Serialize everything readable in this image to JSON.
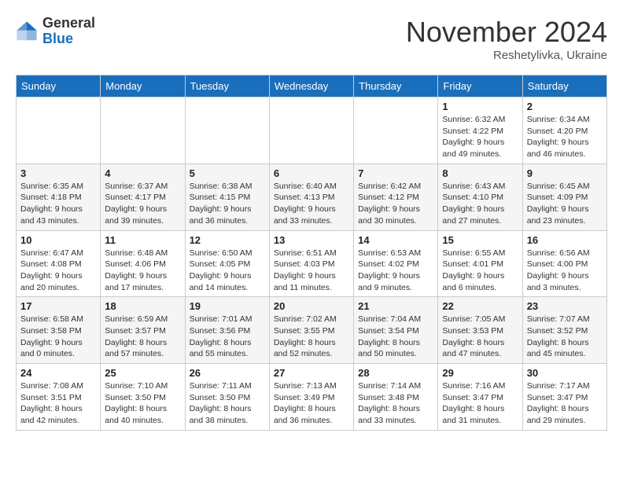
{
  "logo": {
    "general": "General",
    "blue": "Blue"
  },
  "title": "November 2024",
  "subtitle": "Reshetylivka, Ukraine",
  "days_of_week": [
    "Sunday",
    "Monday",
    "Tuesday",
    "Wednesday",
    "Thursday",
    "Friday",
    "Saturday"
  ],
  "weeks": [
    [
      {
        "day": "",
        "detail": ""
      },
      {
        "day": "",
        "detail": ""
      },
      {
        "day": "",
        "detail": ""
      },
      {
        "day": "",
        "detail": ""
      },
      {
        "day": "",
        "detail": ""
      },
      {
        "day": "1",
        "detail": "Sunrise: 6:32 AM\nSunset: 4:22 PM\nDaylight: 9 hours and 49 minutes."
      },
      {
        "day": "2",
        "detail": "Sunrise: 6:34 AM\nSunset: 4:20 PM\nDaylight: 9 hours and 46 minutes."
      }
    ],
    [
      {
        "day": "3",
        "detail": "Sunrise: 6:35 AM\nSunset: 4:18 PM\nDaylight: 9 hours and 43 minutes."
      },
      {
        "day": "4",
        "detail": "Sunrise: 6:37 AM\nSunset: 4:17 PM\nDaylight: 9 hours and 39 minutes."
      },
      {
        "day": "5",
        "detail": "Sunrise: 6:38 AM\nSunset: 4:15 PM\nDaylight: 9 hours and 36 minutes."
      },
      {
        "day": "6",
        "detail": "Sunrise: 6:40 AM\nSunset: 4:13 PM\nDaylight: 9 hours and 33 minutes."
      },
      {
        "day": "7",
        "detail": "Sunrise: 6:42 AM\nSunset: 4:12 PM\nDaylight: 9 hours and 30 minutes."
      },
      {
        "day": "8",
        "detail": "Sunrise: 6:43 AM\nSunset: 4:10 PM\nDaylight: 9 hours and 27 minutes."
      },
      {
        "day": "9",
        "detail": "Sunrise: 6:45 AM\nSunset: 4:09 PM\nDaylight: 9 hours and 23 minutes."
      }
    ],
    [
      {
        "day": "10",
        "detail": "Sunrise: 6:47 AM\nSunset: 4:08 PM\nDaylight: 9 hours and 20 minutes."
      },
      {
        "day": "11",
        "detail": "Sunrise: 6:48 AM\nSunset: 4:06 PM\nDaylight: 9 hours and 17 minutes."
      },
      {
        "day": "12",
        "detail": "Sunrise: 6:50 AM\nSunset: 4:05 PM\nDaylight: 9 hours and 14 minutes."
      },
      {
        "day": "13",
        "detail": "Sunrise: 6:51 AM\nSunset: 4:03 PM\nDaylight: 9 hours and 11 minutes."
      },
      {
        "day": "14",
        "detail": "Sunrise: 6:53 AM\nSunset: 4:02 PM\nDaylight: 9 hours and 9 minutes."
      },
      {
        "day": "15",
        "detail": "Sunrise: 6:55 AM\nSunset: 4:01 PM\nDaylight: 9 hours and 6 minutes."
      },
      {
        "day": "16",
        "detail": "Sunrise: 6:56 AM\nSunset: 4:00 PM\nDaylight: 9 hours and 3 minutes."
      }
    ],
    [
      {
        "day": "17",
        "detail": "Sunrise: 6:58 AM\nSunset: 3:58 PM\nDaylight: 9 hours and 0 minutes."
      },
      {
        "day": "18",
        "detail": "Sunrise: 6:59 AM\nSunset: 3:57 PM\nDaylight: 8 hours and 57 minutes."
      },
      {
        "day": "19",
        "detail": "Sunrise: 7:01 AM\nSunset: 3:56 PM\nDaylight: 8 hours and 55 minutes."
      },
      {
        "day": "20",
        "detail": "Sunrise: 7:02 AM\nSunset: 3:55 PM\nDaylight: 8 hours and 52 minutes."
      },
      {
        "day": "21",
        "detail": "Sunrise: 7:04 AM\nSunset: 3:54 PM\nDaylight: 8 hours and 50 minutes."
      },
      {
        "day": "22",
        "detail": "Sunrise: 7:05 AM\nSunset: 3:53 PM\nDaylight: 8 hours and 47 minutes."
      },
      {
        "day": "23",
        "detail": "Sunrise: 7:07 AM\nSunset: 3:52 PM\nDaylight: 8 hours and 45 minutes."
      }
    ],
    [
      {
        "day": "24",
        "detail": "Sunrise: 7:08 AM\nSunset: 3:51 PM\nDaylight: 8 hours and 42 minutes."
      },
      {
        "day": "25",
        "detail": "Sunrise: 7:10 AM\nSunset: 3:50 PM\nDaylight: 8 hours and 40 minutes."
      },
      {
        "day": "26",
        "detail": "Sunrise: 7:11 AM\nSunset: 3:50 PM\nDaylight: 8 hours and 38 minutes."
      },
      {
        "day": "27",
        "detail": "Sunrise: 7:13 AM\nSunset: 3:49 PM\nDaylight: 8 hours and 36 minutes."
      },
      {
        "day": "28",
        "detail": "Sunrise: 7:14 AM\nSunset: 3:48 PM\nDaylight: 8 hours and 33 minutes."
      },
      {
        "day": "29",
        "detail": "Sunrise: 7:16 AM\nSunset: 3:47 PM\nDaylight: 8 hours and 31 minutes."
      },
      {
        "day": "30",
        "detail": "Sunrise: 7:17 AM\nSunset: 3:47 PM\nDaylight: 8 hours and 29 minutes."
      }
    ]
  ]
}
